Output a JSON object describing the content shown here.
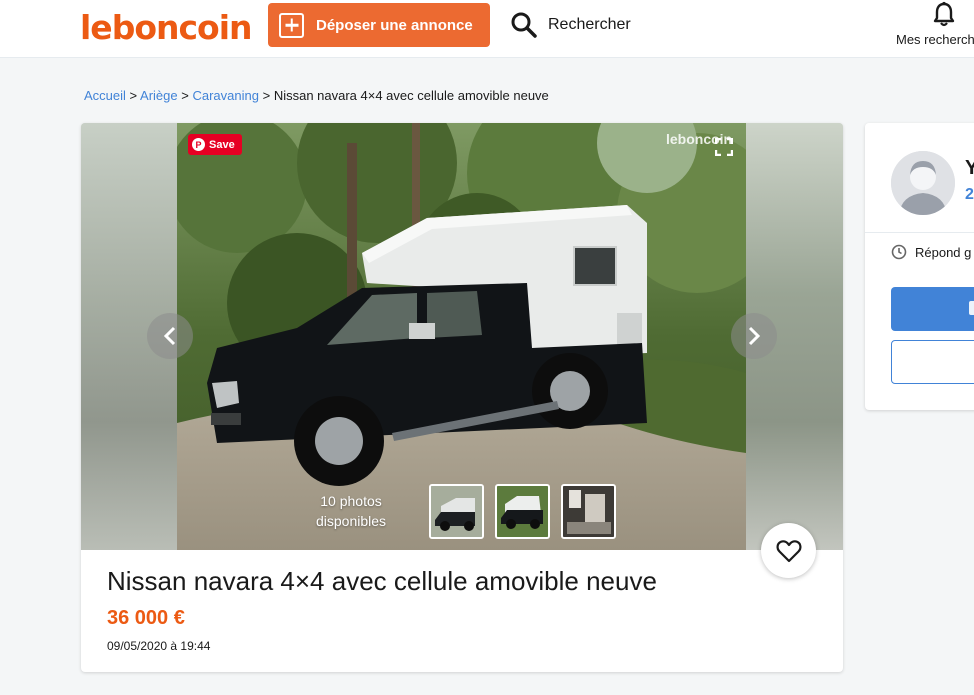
{
  "header": {
    "logo": "leboncoin",
    "post_button": "Déposer une annonce",
    "search_label": "Rechercher",
    "my_searches": "Mes recherches"
  },
  "breadcrumb": {
    "items": [
      "Accueil",
      "Ariège",
      "Caravaning"
    ],
    "separator": ">",
    "current": "Nissan navara 4×4 avec cellule amovible neuve"
  },
  "gallery": {
    "save_label": "Save",
    "pinterest_letter": "P",
    "watermark": "leboncoin",
    "photos_count_line1": "10 photos",
    "photos_count_line2": "disponibles"
  },
  "listing": {
    "title": "Nissan navara 4×4 avec cellule amovible neuve",
    "price": "36 000 €",
    "date": "09/05/2020 à 19:44"
  },
  "seller": {
    "name_initial": "Y",
    "ads_count": "2",
    "response": "Répond g"
  },
  "colors": {
    "brand_orange": "#ec5a13",
    "link_blue": "#4183d7",
    "pinterest_red": "#e60023"
  }
}
